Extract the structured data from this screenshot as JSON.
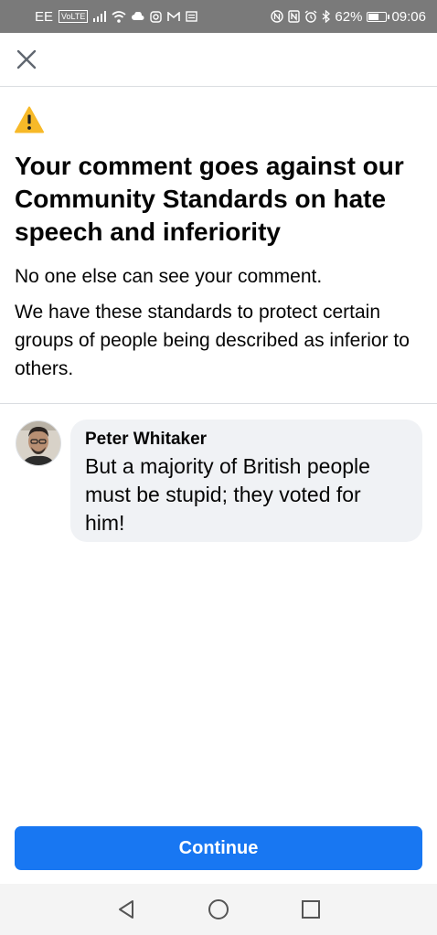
{
  "status_bar": {
    "carrier": "EE",
    "volte": "VoLTE",
    "battery_percent": "62%",
    "battery_level": 0.62,
    "time": "09:06",
    "icons": [
      "signal-icon",
      "wifi-icon",
      "cloud-icon",
      "instagram-icon",
      "gmail-icon",
      "message-icon",
      "nfc-icon",
      "alarm-icon",
      "bluetooth-icon",
      "battery-icon"
    ]
  },
  "header": {
    "close_icon": "close-icon"
  },
  "notice": {
    "icon": "warning-icon",
    "title": "Your comment goes against our Community Standards on hate speech and inferiority",
    "line1": "No one else can see your comment.",
    "line2": "We have these standards to protect certain groups of people being described as inferior to others."
  },
  "comment": {
    "author": "Peter Whitaker",
    "text": "But a majority of British people must be stupid; they voted for him!"
  },
  "actions": {
    "continue_label": "Continue"
  },
  "nav": {
    "back_icon": "back-icon",
    "home_icon": "home-icon",
    "recents_icon": "recents-icon"
  },
  "colors": {
    "primary": "#1877f2",
    "warning": "#f7b928",
    "bubble": "#f0f2f5",
    "status_bar": "#7a7a7a"
  }
}
